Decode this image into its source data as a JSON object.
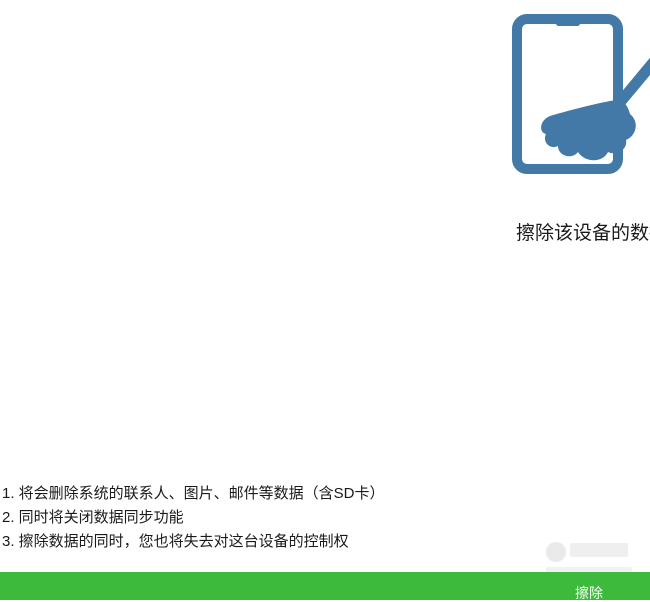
{
  "hero": {
    "icon": "tablet-broom-icon",
    "icon_color": "#4379a6",
    "heading": "擦除该设备的数据"
  },
  "notes": [
    "1. 将会删除系统的联系人、图片、邮件等数据（含SD卡）",
    "2. 同时将关闭数据同步功能",
    "3. 擦除数据的同时，您也将失去对这台设备的控制权"
  ],
  "watermark": {
    "icon": "site-logo-icon"
  },
  "action_bar": {
    "label": "擦除",
    "color": "#3dba3b"
  }
}
